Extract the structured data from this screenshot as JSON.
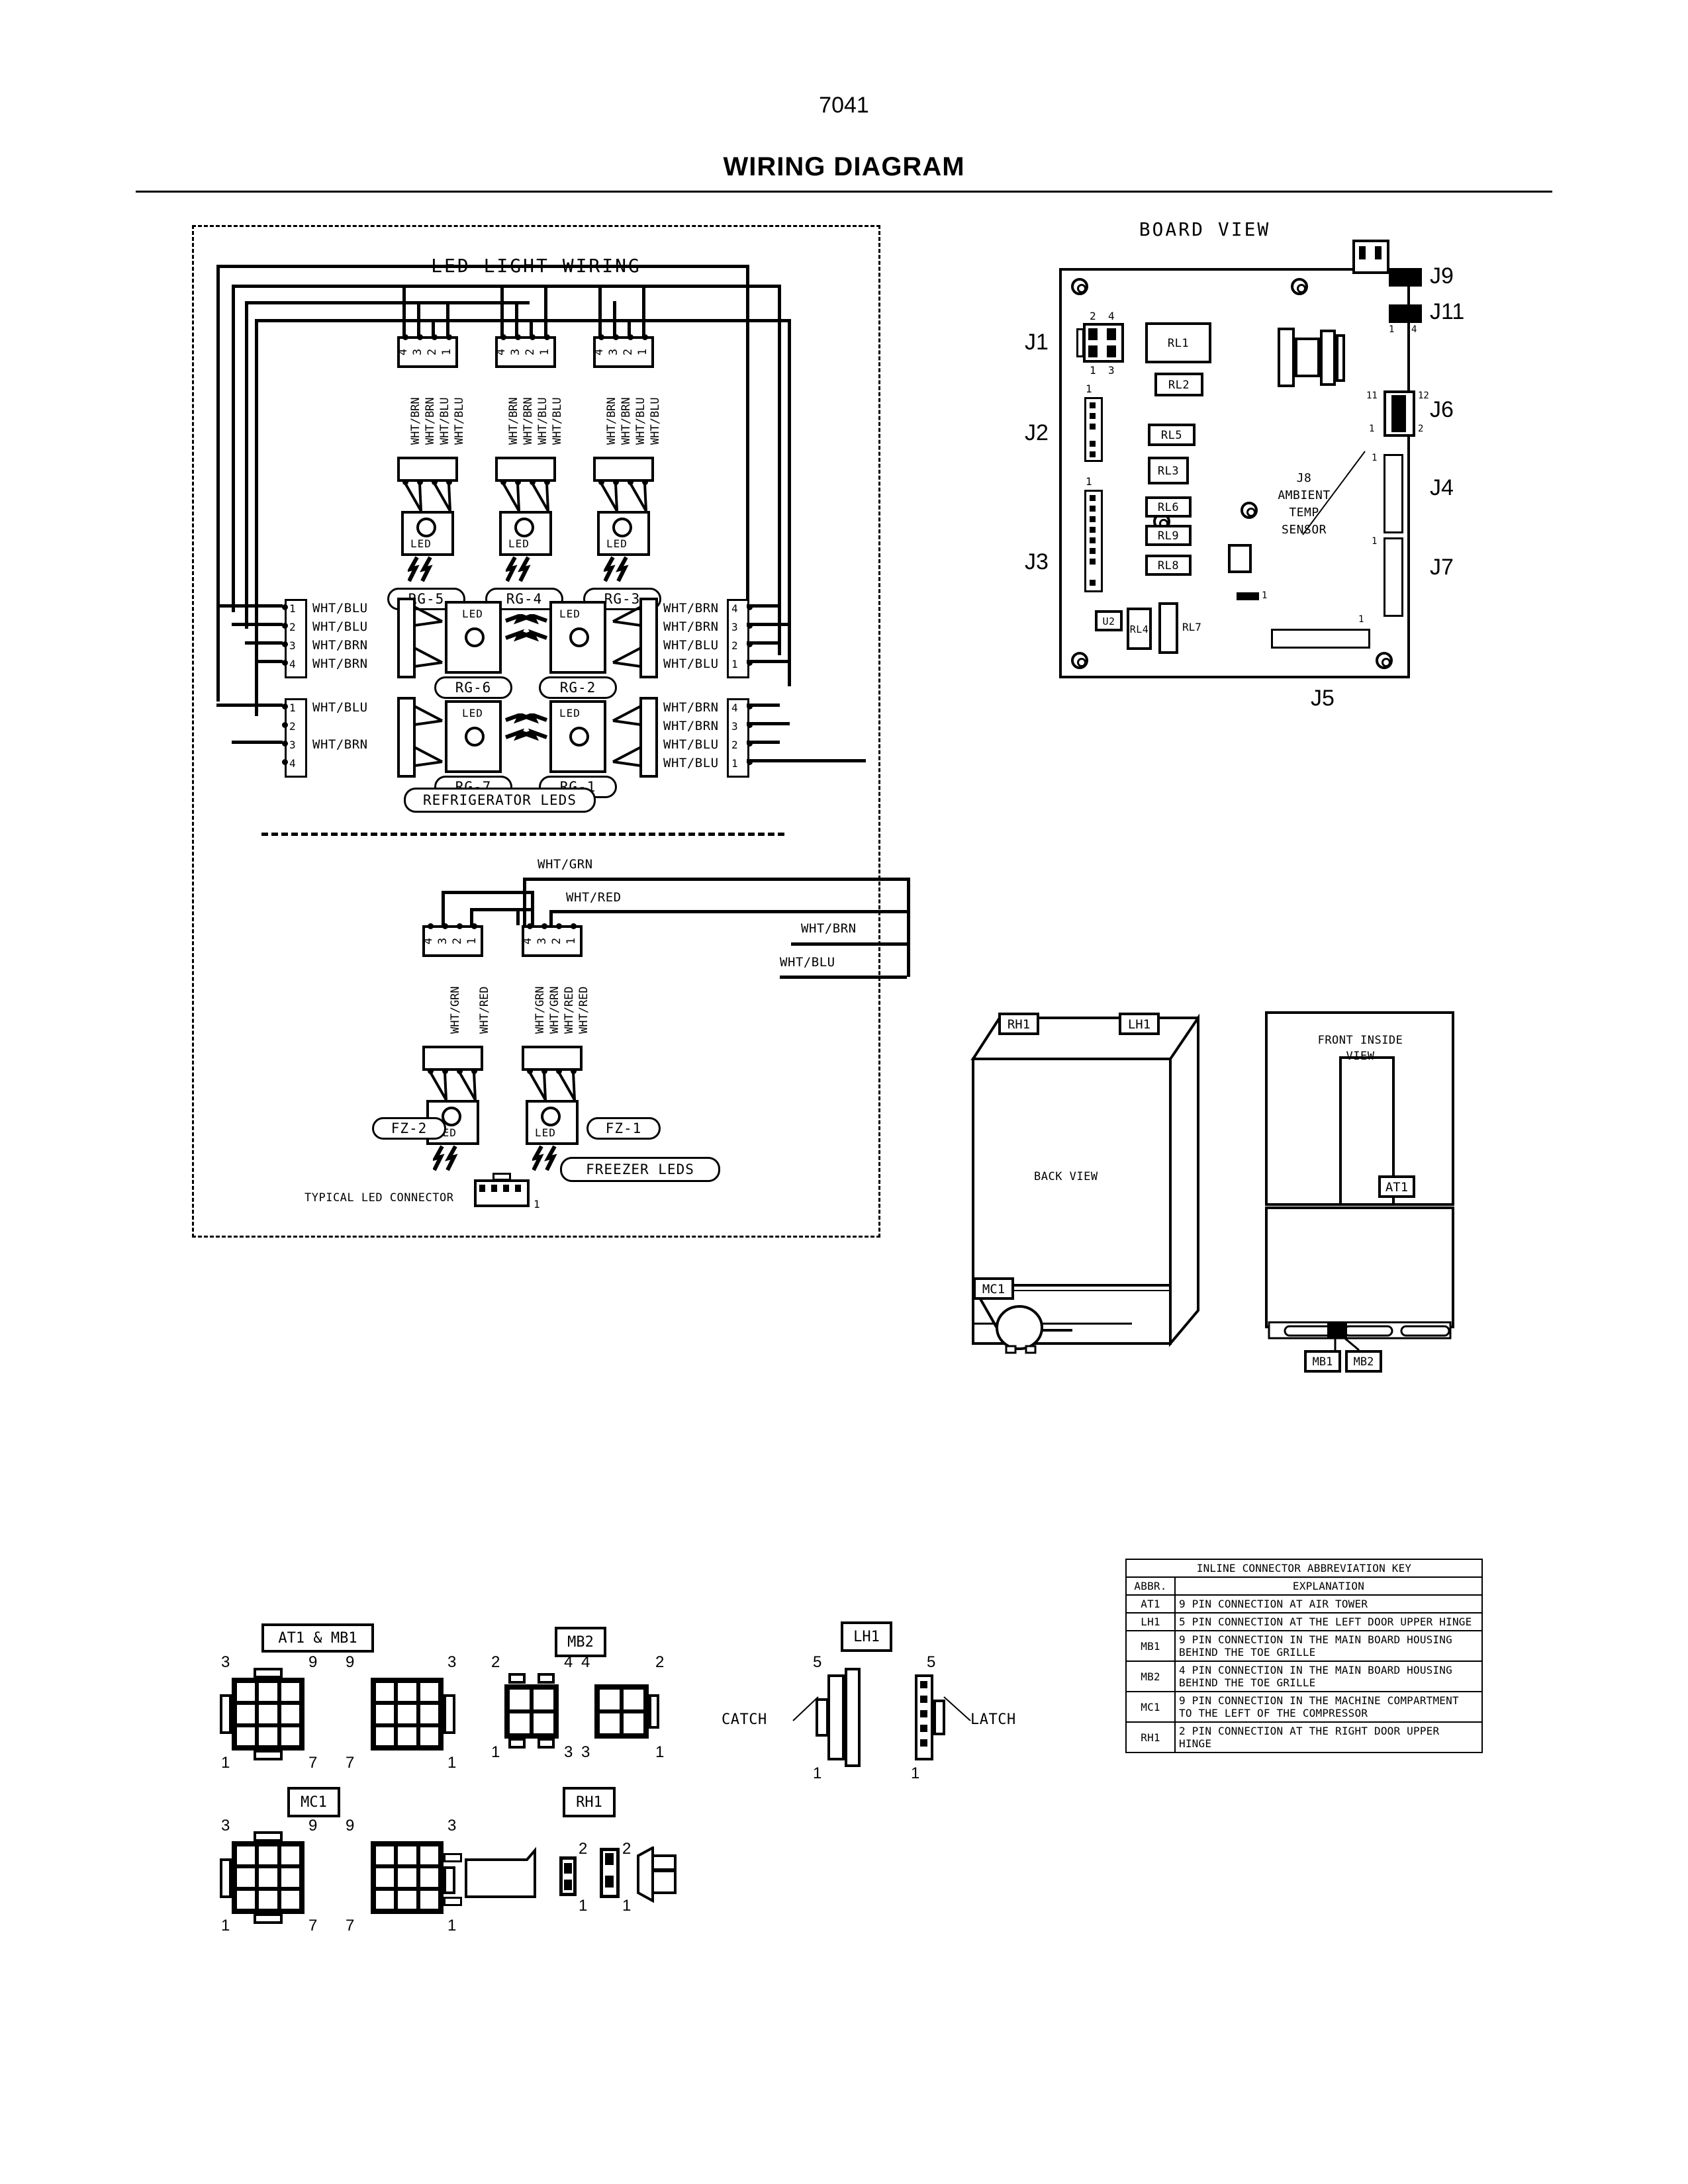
{
  "header": {
    "doc_number": "7041",
    "title": "WIRING DIAGRAM"
  },
  "led_panel": {
    "title": "LED LIGHT WIRING",
    "refrigerator_group_label": "REFRIGERATOR LEDS",
    "freezer_group_label": "FREEZER LEDS",
    "typical_connector_label": "TYPICAL LED CONNECTOR",
    "typical_connector_pin": "1",
    "led_text": "LED",
    "top_modules": [
      {
        "id": "RG-5",
        "pins": [
          "4",
          "3",
          "2",
          "1"
        ],
        "wires": [
          "WHT/BRN",
          "WHT/BRN",
          "WHT/BLU",
          "WHT/BLU"
        ]
      },
      {
        "id": "RG-4",
        "pins": [
          "4",
          "3",
          "2",
          "1"
        ],
        "wires": [
          "WHT/BRN",
          "WHT/BRN",
          "WHT/BLU",
          "WHT/BLU"
        ]
      },
      {
        "id": "RG-3",
        "pins": [
          "4",
          "3",
          "2",
          "1"
        ],
        "wires": [
          "WHT/BRN",
          "WHT/BRN",
          "WHT/BLU",
          "WHT/BLU"
        ]
      }
    ],
    "left_modules": [
      {
        "id": "RG-6",
        "pins": [
          "1",
          "2",
          "3",
          "4"
        ],
        "wires": [
          "WHT/BLU",
          "WHT/BLU",
          "WHT/BRN",
          "WHT/BRN"
        ]
      },
      {
        "id": "RG-7",
        "pins": [
          "1",
          "2",
          "3",
          "4"
        ],
        "wires": [
          "WHT/BLU",
          "",
          "WHT/BRN",
          ""
        ]
      }
    ],
    "right_modules": [
      {
        "id": "RG-2",
        "pins": [
          "4",
          "3",
          "2",
          "1"
        ],
        "wires": [
          "WHT/BRN",
          "WHT/BRN",
          "WHT/BLU",
          "WHT/BLU"
        ]
      },
      {
        "id": "RG-1",
        "pins": [
          "4",
          "3",
          "2",
          "1"
        ],
        "wires": [
          "WHT/BRN",
          "WHT/BRN",
          "WHT/BLU",
          "WHT/BLU"
        ]
      }
    ],
    "freezer_modules": [
      {
        "id": "FZ-2",
        "pins": [
          "4",
          "3",
          "2",
          "1"
        ],
        "wires": [
          "",
          "WHT/GRN",
          "",
          "WHT/RED"
        ]
      },
      {
        "id": "FZ-1",
        "pins": [
          "4",
          "3",
          "2",
          "1"
        ],
        "wires": [
          "WHT/GRN",
          "WHT/GRN",
          "WHT/RED",
          "WHT/RED"
        ]
      }
    ],
    "bus_labels": [
      "WHT/GRN",
      "WHT/RED",
      "WHT/BRN",
      "WHT/BLU"
    ]
  },
  "board": {
    "title": "BOARD VIEW",
    "connectors": [
      "J1",
      "J2",
      "J3",
      "J4",
      "J5",
      "J6",
      "J7",
      "J9",
      "J11"
    ],
    "sensor_label": "J8\nAMBIENT\nTEMP\nSENSOR",
    "sensor_lines": [
      "J8",
      "AMBIENT",
      "TEMP",
      "SENSOR"
    ],
    "relays": [
      "RL1",
      "RL2",
      "RL5",
      "RL3",
      "RL6",
      "RL9",
      "RL8",
      "RL4",
      "RL7"
    ],
    "ic": "U2",
    "j1_pins": {
      "top_left": "2",
      "top_right": "4",
      "bottom_left": "1",
      "bottom_right": "3"
    },
    "j11_pins": {
      "left": "1",
      "right": "4"
    },
    "j6_pins": {
      "top_left": "11",
      "top_right": "12",
      "bottom_left": "1",
      "bottom_right": "2"
    },
    "j4_pin1": "1",
    "j7_pin1": "1",
    "j2_pin1": "1",
    "j3_pin1": "1",
    "j5_pin1": "1",
    "misc_pin1": "1"
  },
  "appliance_views": {
    "back_view_label": "BACK VIEW",
    "front_inside_label_line1": "FRONT INSIDE",
    "front_inside_label_line2": "VIEW",
    "back_tags": [
      "RH1",
      "LH1",
      "MC1"
    ],
    "front_tags": [
      "AT1",
      "MB1",
      "MB2"
    ]
  },
  "connector_figures": {
    "at1_mb1": {
      "label": "AT1 & MB1",
      "left_tl": "3",
      "left_tr": "9",
      "left_bl": "1",
      "left_br": "7",
      "right_tl": "9",
      "right_tr": "3",
      "right_bl": "7",
      "right_br": "1"
    },
    "mb2": {
      "label": "MB2",
      "left_tl": "2",
      "left_tr": "4",
      "left_bl": "1",
      "left_br": "3",
      "right_tl": "4",
      "right_tr": "2",
      "right_bl": "3",
      "right_br": "1"
    },
    "lh1": {
      "label": "LH1",
      "catch_label": "CATCH",
      "latch_label": "LATCH",
      "left_top": "5",
      "left_bottom": "1",
      "right_top": "5",
      "right_bottom": "1"
    },
    "mc1": {
      "label": "MC1",
      "left_tl": "3",
      "left_tr": "9",
      "left_bl": "1",
      "left_br": "7",
      "right_tl": "9",
      "right_tr": "3",
      "right_bl": "7",
      "right_br": "1"
    },
    "rh1": {
      "label": "RH1",
      "left_top": "2",
      "left_bottom": "1",
      "right_top": "2",
      "right_bottom": "1"
    }
  },
  "key_table": {
    "title": "INLINE CONNECTOR ABBREVIATION KEY",
    "columns": [
      "ABBR.",
      "EXPLANATION"
    ],
    "rows": [
      {
        "abbr": "AT1",
        "explanation": "9 PIN CONNECTION AT AIR TOWER"
      },
      {
        "abbr": "LH1",
        "explanation": "5 PIN CONNECTION AT THE LEFT DOOR UPPER HINGE"
      },
      {
        "abbr": "MB1",
        "explanation": "9 PIN CONNECTION IN THE MAIN BOARD HOUSING BEHIND THE TOE GRILLE"
      },
      {
        "abbr": "MB2",
        "explanation": "4 PIN CONNECTION IN THE MAIN BOARD HOUSING BEHIND THE TOE GRILLE"
      },
      {
        "abbr": "MC1",
        "explanation": "9 PIN CONNECTION IN THE MACHINE COMPARTMENT TO THE LEFT OF THE COMPRESSOR"
      },
      {
        "abbr": "RH1",
        "explanation": "2 PIN CONNECTION AT THE RIGHT DOOR UPPER HINGE"
      }
    ]
  }
}
